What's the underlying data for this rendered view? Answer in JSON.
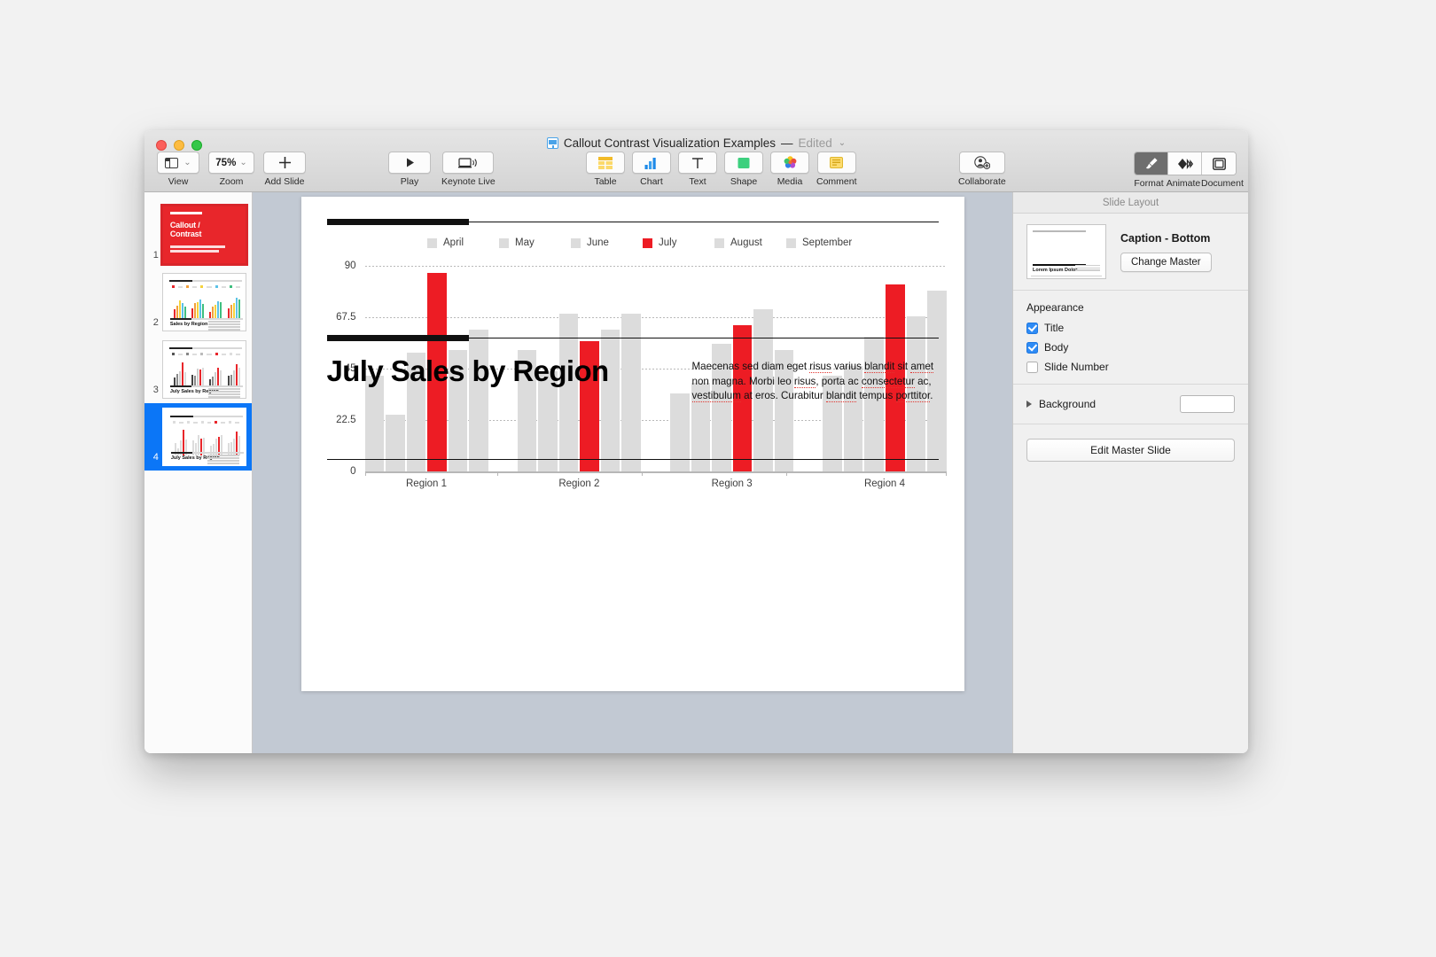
{
  "window": {
    "title": "Callout Contrast Visualization Examples",
    "separator": "—",
    "edited_label": "Edited",
    "doc_icon": "keynote-document-icon"
  },
  "toolbar": {
    "view": {
      "label": "View",
      "icon": "sidebar-layout-icon",
      "chevron": "chevron-down-icon"
    },
    "zoom": {
      "label": "Zoom",
      "value": "75%",
      "chevron": "chevron-down-icon"
    },
    "add_slide": {
      "label": "Add Slide",
      "icon": "plus-icon"
    },
    "play": {
      "label": "Play",
      "icon": "play-triangle-icon"
    },
    "keynote_live": {
      "label": "Keynote Live",
      "icon": "laptop-broadcast-icon"
    },
    "insert": [
      {
        "label": "Table",
        "icon": "table-grid-icon"
      },
      {
        "label": "Chart",
        "icon": "bar-chart-icon"
      },
      {
        "label": "Text",
        "icon": "text-t-icon"
      },
      {
        "label": "Shape",
        "icon": "green-square-shape-icon"
      },
      {
        "label": "Media",
        "icon": "photos-flower-icon"
      },
      {
        "label": "Comment",
        "icon": "comment-lines-icon"
      }
    ],
    "collaborate": {
      "label": "Collaborate",
      "icon": "person-add-icon"
    },
    "right_segments": [
      {
        "label": "Format",
        "icon": "paintbrush-icon",
        "active": true
      },
      {
        "label": "Animate",
        "icon": "diamond-motion-icon",
        "active": false
      },
      {
        "label": "Document",
        "icon": "document-square-icon",
        "active": false
      }
    ]
  },
  "navigator": {
    "slides": [
      {
        "number": "1",
        "type": "title",
        "title": "Callout /\nContrast",
        "selected": false
      },
      {
        "number": "2",
        "type": "chart",
        "footer_title": "Sales by Region",
        "selected": false
      },
      {
        "number": "3",
        "type": "chart",
        "footer_title": "July Sales by Region",
        "selected": false
      },
      {
        "number": "4",
        "type": "chart",
        "footer_title": "July Sales by Region",
        "selected": true
      }
    ]
  },
  "slide": {
    "caption_title": "July Sales by Region",
    "caption_body_parts": [
      {
        "t": "Maecenas sed diam eget ",
        "sp": false
      },
      {
        "t": "risus",
        "sp": true
      },
      {
        "t": " varius ",
        "sp": false
      },
      {
        "t": "blandit",
        "sp": true
      },
      {
        "t": " sit ",
        "sp": false
      },
      {
        "t": "amet",
        "sp": true
      },
      {
        "t": " non magna. Morbi leo ",
        "sp": false
      },
      {
        "t": "risus",
        "sp": true
      },
      {
        "t": ", porta ac ",
        "sp": false
      },
      {
        "t": "consectetur",
        "sp": true
      },
      {
        "t": " ac, ",
        "sp": false
      },
      {
        "t": "vestibulum",
        "sp": true
      },
      {
        "t": " at eros. Curabitur ",
        "sp": false
      },
      {
        "t": "blandit",
        "sp": true
      },
      {
        "t": " tempus ",
        "sp": false
      },
      {
        "t": "porttitor",
        "sp": true
      },
      {
        "t": ".",
        "sp": false
      }
    ]
  },
  "inspector": {
    "header": "Slide Layout",
    "master_name": "Caption - Bottom",
    "change_master_label": "Change Master",
    "master_thumb_text": "Lorem Ipsum Dolor",
    "appearance_label": "Appearance",
    "appearance_options": [
      {
        "label": "Title",
        "checked": true
      },
      {
        "label": "Body",
        "checked": true
      },
      {
        "label": "Slide Number",
        "checked": false
      }
    ],
    "background_label": "Background",
    "background_color": "#ffffff",
    "edit_master_label": "Edit Master Slide"
  },
  "colors": {
    "highlight": "#ed1c24",
    "muted_bar": "#dcdcdc",
    "accent_blue": "#0b76f7",
    "title_red": "#e8262b"
  },
  "chart_data": {
    "type": "bar",
    "title": "July Sales by Region",
    "xlabel": "",
    "ylabel": "",
    "ylim": [
      0,
      90
    ],
    "yticks": [
      0,
      22.5,
      45,
      67.5,
      90
    ],
    "ytick_labels": [
      "0",
      "22.5",
      "45",
      "67.5",
      "90"
    ],
    "grid": true,
    "legend_position": "top-center",
    "categories": [
      "Region 1",
      "Region 2",
      "Region 3",
      "Region 4"
    ],
    "highlight_series": "July",
    "series": [
      {
        "name": "April",
        "color": "#dcdcdc",
        "values": [
          42,
          53,
          34,
          42
        ]
      },
      {
        "name": "May",
        "color": "#dcdcdc",
        "values": [
          25,
          44,
          39,
          46
        ]
      },
      {
        "name": "June",
        "color": "#dcdcdc",
        "values": [
          52,
          69,
          56,
          59
        ]
      },
      {
        "name": "July",
        "color": "#ed1c24",
        "values": [
          87,
          57,
          64,
          82
        ]
      },
      {
        "name": "August",
        "color": "#dcdcdc",
        "values": [
          53,
          62,
          71,
          68
        ]
      },
      {
        "name": "September",
        "color": "#dcdcdc",
        "values": [
          62,
          69,
          53,
          79
        ]
      }
    ]
  }
}
